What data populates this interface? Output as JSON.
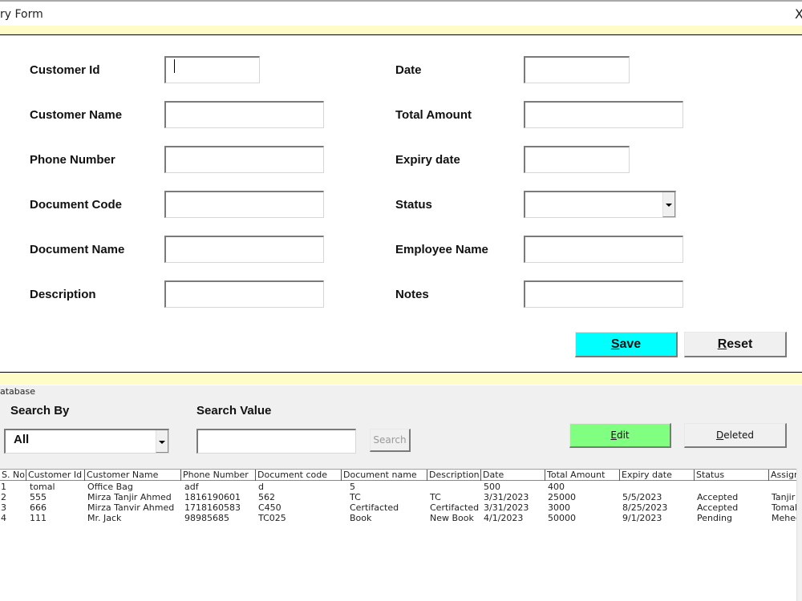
{
  "window": {
    "title": "ry Form",
    "close_glyph": "X"
  },
  "form": {
    "left_fields": [
      {
        "label": "Customer Id",
        "value": ""
      },
      {
        "label": "Customer Name",
        "value": ""
      },
      {
        "label": "Phone Number",
        "value": ""
      },
      {
        "label": "Document Code",
        "value": ""
      },
      {
        "label": "Document Name",
        "value": ""
      },
      {
        "label": "Description",
        "value": ""
      }
    ],
    "right_fields": [
      {
        "label": "Date",
        "value": ""
      },
      {
        "label": "Total Amount",
        "value": ""
      },
      {
        "label": "Expiry date",
        "value": ""
      },
      {
        "label": "Status",
        "value": ""
      },
      {
        "label": "Employee Name",
        "value": ""
      },
      {
        "label": "Notes",
        "value": ""
      }
    ],
    "save_button": {
      "accel": "S",
      "rest": "ave",
      "color": "#00ffff"
    },
    "reset_button": {
      "accel": "R",
      "rest": "eset",
      "color": "#f0f0f0"
    }
  },
  "database": {
    "caption": "atabase",
    "search_by_label": "Search By",
    "search_by_value": "All",
    "search_value_label": "Search Value",
    "search_value": "",
    "search_button": "Search",
    "edit_button": {
      "accel": "E",
      "rest": "dit",
      "color": "#80ff80"
    },
    "delete_button": {
      "accel": "D",
      "rest": "eleted",
      "color": "#f0f0f0"
    }
  },
  "table": {
    "columns": [
      "S. No",
      "Customer Id",
      "Customer Name",
      "Phone Number",
      "Document code",
      "Document name",
      "Description",
      "Date",
      "Total Amount",
      "Expiry date",
      "Status",
      "Assign"
    ],
    "rows": [
      [
        "1",
        "tomal",
        "Office Bag",
        "adf",
        "d",
        "5",
        "",
        "500",
        "400",
        "",
        "",
        ""
      ],
      [
        "2",
        "555",
        "Mirza Tanjir Ahmed",
        "1816190601",
        "562",
        "TC",
        "TC",
        "3/31/2023",
        "25000",
        "5/5/2023",
        "Accepted",
        "Tanjir"
      ],
      [
        "3",
        "666",
        "Mirza Tanvir Ahmed",
        "1718160583",
        "C450",
        "Certifacted",
        "Certifacted",
        "3/31/2023",
        "3000",
        "8/25/2023",
        "Accepted",
        "Tomal"
      ],
      [
        "4",
        "111",
        "Mr. Jack",
        "98985685",
        "TC025",
        "Book",
        "New Book",
        "4/1/2023",
        "50000",
        "9/1/2023",
        "Pending",
        "Mehec"
      ]
    ]
  }
}
